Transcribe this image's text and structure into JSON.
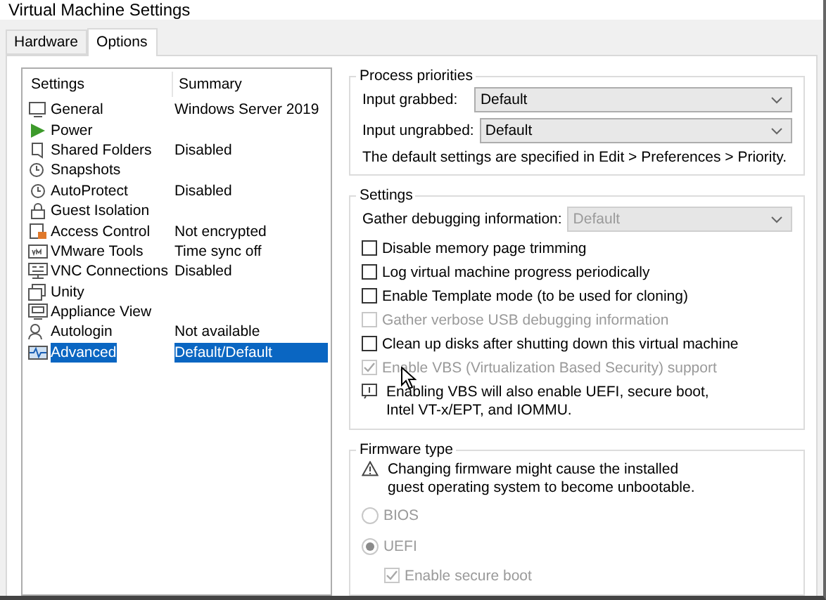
{
  "window": {
    "title": "Virtual Machine Settings"
  },
  "tabs": [
    {
      "label": "Hardware",
      "selected": false
    },
    {
      "label": "Options",
      "selected": true
    }
  ],
  "settings_list": {
    "columns": [
      "Settings",
      "Summary"
    ],
    "rows": [
      {
        "name": "General",
        "summary": "Windows Server 2019",
        "selected": false
      },
      {
        "name": "Power",
        "summary": "",
        "selected": false
      },
      {
        "name": "Shared Folders",
        "summary": "Disabled",
        "selected": false
      },
      {
        "name": "Snapshots",
        "summary": "",
        "selected": false
      },
      {
        "name": "AutoProtect",
        "summary": "Disabled",
        "selected": false
      },
      {
        "name": "Guest Isolation",
        "summary": "",
        "selected": false
      },
      {
        "name": "Access Control",
        "summary": "Not encrypted",
        "selected": false
      },
      {
        "name": "VMware Tools",
        "summary": "Time sync off",
        "selected": false
      },
      {
        "name": "VNC Connections",
        "summary": "Disabled",
        "selected": false
      },
      {
        "name": "Unity",
        "summary": "",
        "selected": false
      },
      {
        "name": "Appliance View",
        "summary": "",
        "selected": false
      },
      {
        "name": "Autologin",
        "summary": "Not available",
        "selected": false
      },
      {
        "name": "Advanced",
        "summary": "Default/Default",
        "selected": true
      }
    ]
  },
  "process_priorities": {
    "title": "Process priorities",
    "fields": [
      {
        "label": "Input grabbed:",
        "value": "Default"
      },
      {
        "label": "Input ungrabbed:",
        "value": "Default"
      }
    ],
    "note": "The default settings are specified in Edit > Preferences > Priority."
  },
  "settings": {
    "title": "Settings",
    "debug": {
      "label": "Gather debugging information:",
      "value": "Default",
      "disabled": true
    },
    "options": [
      {
        "label": "Disable memory page trimming",
        "checked": false,
        "disabled": false
      },
      {
        "label": "Log virtual machine progress periodically",
        "checked": false,
        "disabled": false
      },
      {
        "label": "Enable Template mode (to be used for cloning)",
        "checked": false,
        "disabled": false
      },
      {
        "label": "Gather verbose USB debugging information",
        "checked": false,
        "disabled": true
      },
      {
        "label": "Clean up disks after shutting down this virtual machine",
        "checked": false,
        "disabled": false
      },
      {
        "label": "Enable VBS (Virtualization Based Security) support",
        "checked": true,
        "disabled": true
      }
    ],
    "info": "Enabling VBS will also enable UEFI, secure boot, Intel VT-x/EPT, and IOMMU."
  },
  "firmware": {
    "title": "Firmware type",
    "warning": "Changing firmware might cause the installed guest operating system to become unbootable.",
    "types": [
      {
        "label": "BIOS",
        "selected": false,
        "disabled": true
      },
      {
        "label": "UEFI",
        "selected": true,
        "disabled": true
      }
    ],
    "secure_boot": {
      "label": "Enable secure boot",
      "checked": true,
      "disabled": true
    }
  }
}
